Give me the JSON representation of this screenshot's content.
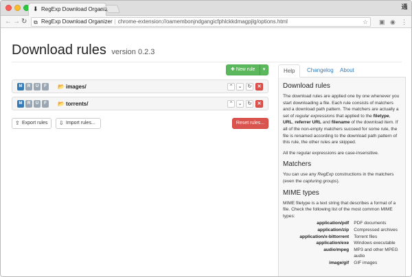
{
  "browser": {
    "tab_title": "RegExp Download Organizer",
    "tab_close": "×",
    "window_button": "通",
    "site_name": "RegExp Download Organizer",
    "url": "chrome-extension://oamembonjndgangicfphlckkdmagpjlg/options.html"
  },
  "page": {
    "title": "Download rules",
    "version": "version 0.2.3"
  },
  "toolbar": {
    "new_rule": "New rule"
  },
  "rules": [
    {
      "folder": "images/",
      "tags": [
        {
          "letter": "M",
          "active": true
        },
        {
          "letter": "R",
          "active": false
        },
        {
          "letter": "U",
          "active": false
        },
        {
          "letter": "F",
          "active": false
        }
      ]
    },
    {
      "folder": "torrents/",
      "tags": [
        {
          "letter": "M",
          "active": true
        },
        {
          "letter": "R",
          "active": false
        },
        {
          "letter": "U",
          "active": false
        },
        {
          "letter": "F",
          "active": false
        }
      ]
    }
  ],
  "actions": {
    "export": "Export rules",
    "import": "Import rules...",
    "reset": "Reset rules..."
  },
  "help": {
    "tabs": [
      "Help",
      "Changelog",
      "About"
    ],
    "active_tab": "Help",
    "h_rules": "Download rules",
    "p1_a": "The download rules are applied one by one whenever you start downloading a file. Each rule consists of matchers and a download path pattern. The matchers are actually a set of ",
    "p1_em": "regular expressions",
    "p1_b": " that applied to the ",
    "p1_filetype": "filetype",
    "p1_c": ", ",
    "p1_url": "URL",
    "p1_d": ", ",
    "p1_ref": "referrer URL",
    "p1_e": " and ",
    "p1_fname": "filename",
    "p1_f": " of the download item. If all of the non-empty matchers succeed for some rule, the file is renamed according to the download path pattern of this rule, the other rules are skipped.",
    "p2": "All the regular expressions are case-insensitive.",
    "h_matchers": "Matchers",
    "p3_a": "You can use any ",
    "p3_em1": "RegExp",
    "p3_b": " constructions in the matchers (even the ",
    "p3_em2": "capturing groups",
    "p3_c": ").",
    "h_mime": "MIME types",
    "p4": "MIME filetype is a text string that describes a format of a file. Check the following list of the most common MIME types:",
    "mime": [
      {
        "type": "application/pdf",
        "desc": "PDF documents"
      },
      {
        "type": "application/zip",
        "desc": "Compressed archives"
      },
      {
        "type": "application/x-bittorrent",
        "desc": "Torrent files"
      },
      {
        "type": "application/exe",
        "desc": "Windows executable"
      },
      {
        "type": "audio/mpeg",
        "desc": "MP3 and other MPEG"
      },
      {
        "type": "",
        "desc": "audio"
      },
      {
        "type": "image/gif",
        "desc": "GIF images"
      }
    ]
  },
  "colors": {
    "success": "#5cb85c",
    "danger": "#d9534f",
    "primary": "#337ab7",
    "link": "#337ab7"
  },
  "icons": [
    "download-icon",
    "back-arrow-icon",
    "forward-arrow-icon",
    "reload-icon",
    "puzzle-icon",
    "star-icon",
    "plus-icon",
    "caret-down-icon",
    "folder-open-icon",
    "chevron-up-icon",
    "chevron-down-icon",
    "refresh-icon",
    "remove-icon",
    "export-icon",
    "import-icon"
  ]
}
